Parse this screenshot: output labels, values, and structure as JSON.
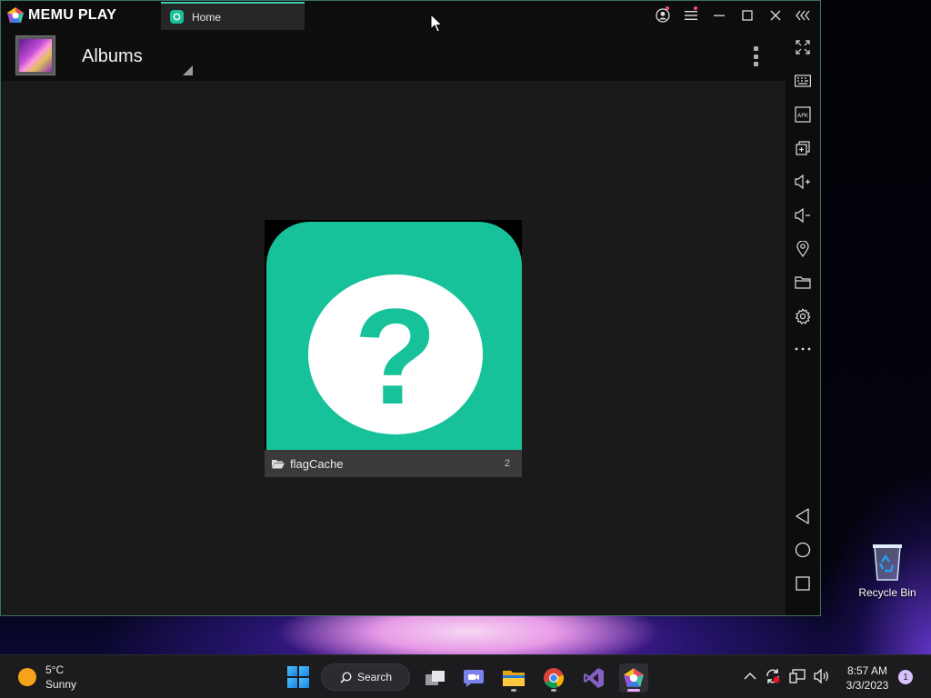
{
  "emulator": {
    "brand": "MEMU PLAY",
    "tab_label": "Home",
    "window_controls": [
      "account-icon",
      "menu-icon",
      "minimize-icon",
      "maximize-icon",
      "close-icon",
      "collapse-toolbar-icon"
    ],
    "toolbar": [
      "fullscreen-icon",
      "keyboard-icon",
      "apk-icon",
      "multi-instance-icon",
      "volume-up-icon",
      "volume-down-icon",
      "location-icon",
      "folder-icon",
      "settings-icon",
      "more-icon",
      "back-icon",
      "home-icon",
      "recents-icon"
    ]
  },
  "gallery": {
    "title": "Albums",
    "albums": [
      {
        "name": "flagCache",
        "count": "2"
      }
    ]
  },
  "desktop": {
    "recycle_bin_label": "Recycle Bin"
  },
  "taskbar": {
    "weather_temp": "5°C",
    "weather_desc": "Sunny",
    "search_label": "Search",
    "time": "8:57 AM",
    "date": "3/3/2023",
    "notification_count": "1"
  },
  "colors": {
    "accent_teal": "#17c29a",
    "tab_border": "#3fc9b0"
  }
}
